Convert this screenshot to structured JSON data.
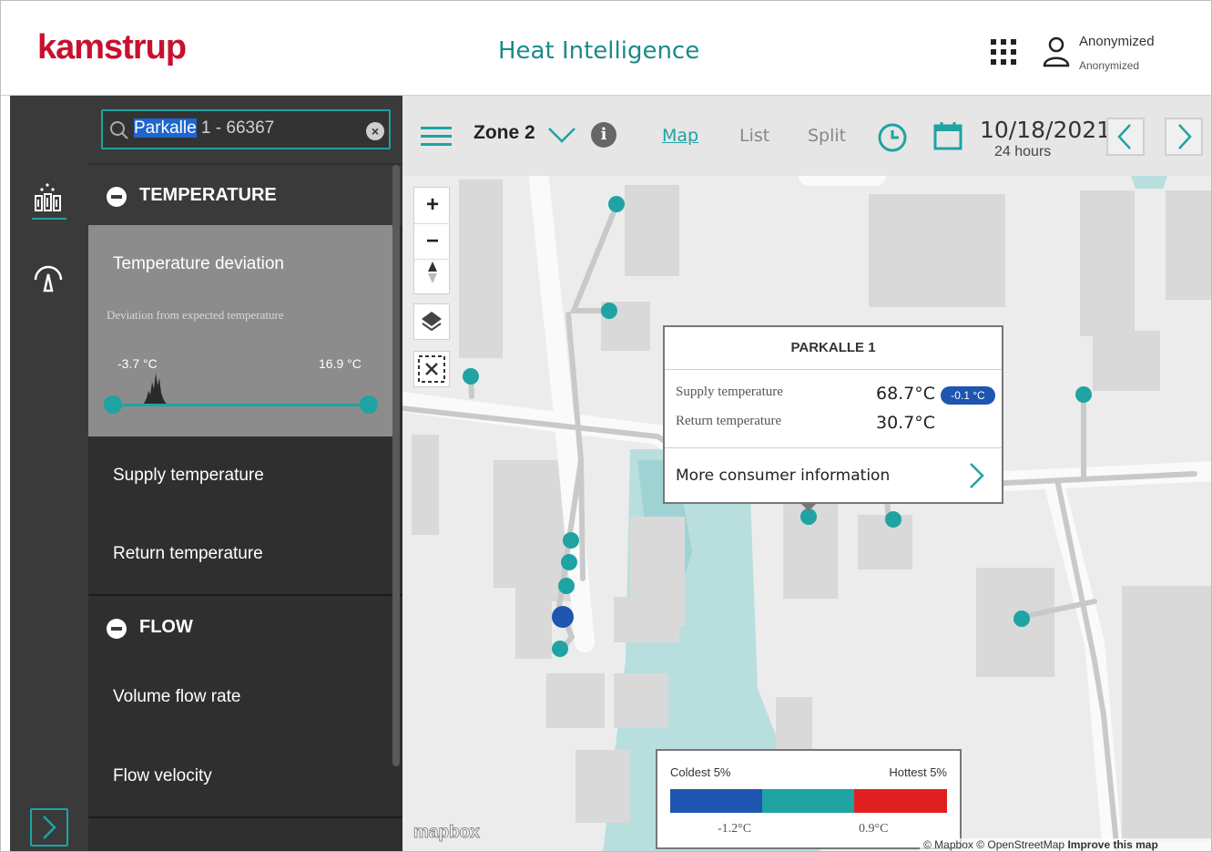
{
  "header": {
    "brand": "kamstrup",
    "app_title": "Heat Intelligence",
    "user_name": "Anonymized",
    "user_org": "Anonymized"
  },
  "rail": {
    "items": [
      {
        "icon": "heat-network-icon"
      },
      {
        "icon": "gauge-icon"
      }
    ],
    "expand_icon": "chevron-right-icon"
  },
  "search": {
    "value_highlight": "Parkalle",
    "value_rest": " 1 - 66367"
  },
  "panel": {
    "temperature": {
      "heading": "TEMPERATURE",
      "active_item": {
        "title": "Temperature deviation",
        "description": "Deviation from expected temperature",
        "min_label": "-3.7 °C",
        "max_label": "16.9 °C"
      },
      "items": [
        "Supply temperature",
        "Return temperature"
      ]
    },
    "flow": {
      "heading": "FLOW",
      "items": [
        "Volume flow rate",
        "Flow velocity"
      ]
    }
  },
  "toolbar": {
    "zone": "Zone 2",
    "tabs": [
      "Map",
      "List",
      "Split"
    ],
    "active_tab": "Map",
    "date": "10/18/2021",
    "range": "24 hours"
  },
  "popup": {
    "title": "PARKALLE 1",
    "supply_label": "Supply temperature",
    "supply_value": "68.7°C",
    "supply_badge": "-0.1 °C",
    "return_label": "Return temperature",
    "return_value": "30.7°C",
    "link": "More consumer information"
  },
  "legend": {
    "left": "Coldest 5%",
    "right": "Hottest 5%",
    "v1": "-1.2°C",
    "v2": "0.9°C",
    "colors": {
      "cold": "#1e55b0",
      "mid": "#1fa3a3",
      "hot": "#e02020"
    }
  },
  "map": {
    "provider": "mapbox",
    "attribution_a": "© Mapbox © OpenStreetMap ",
    "attribution_b": "Improve this map"
  },
  "colors": {
    "brand": "#c8102e",
    "accent": "#1fa3a3",
    "selected_dot": "#1e55b0"
  }
}
